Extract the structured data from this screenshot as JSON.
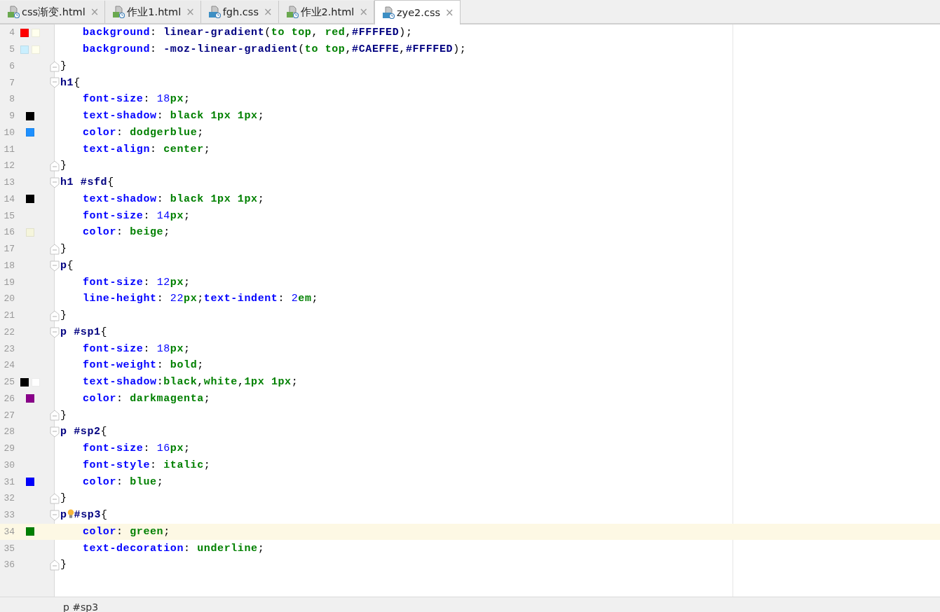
{
  "tabs": [
    {
      "label": "css渐变.html",
      "kind": "html",
      "selected": false
    },
    {
      "label": "作业1.html",
      "kind": "html",
      "selected": false
    },
    {
      "label": "fgh.css",
      "kind": "css",
      "selected": false
    },
    {
      "label": "作业2.html",
      "kind": "html",
      "selected": false
    },
    {
      "label": "zye2.css",
      "kind": "css",
      "selected": true
    }
  ],
  "tab_close": "×",
  "lines": [
    {
      "number": "4",
      "kind": "decl",
      "current": false,
      "bulb": false,
      "swatches": [
        {
          "color": "#ff0000"
        },
        {
          "color": "#ffffed"
        }
      ],
      "tokens": [
        {
          "text": "background",
          "kind": "p"
        },
        {
          "text": ": ",
          "kind": "x"
        },
        {
          "text": "linear-gradient",
          "kind": "f"
        },
        {
          "text": "(",
          "kind": "x"
        },
        {
          "text": "to top",
          "kind": "v"
        },
        {
          "text": ", ",
          "kind": "x"
        },
        {
          "text": "red",
          "kind": "v"
        },
        {
          "text": ",",
          "kind": "x"
        },
        {
          "text": "#FFFFED",
          "kind": "f"
        },
        {
          "text": ");",
          "kind": "x"
        }
      ]
    },
    {
      "number": "5",
      "kind": "decl",
      "current": false,
      "bulb": false,
      "swatches": [
        {
          "color": "#caeffe"
        },
        {
          "color": "#ffffed"
        }
      ],
      "tokens": [
        {
          "text": "background",
          "kind": "p"
        },
        {
          "text": ": ",
          "kind": "x"
        },
        {
          "text": "-moz-linear-gradient",
          "kind": "f"
        },
        {
          "text": "(",
          "kind": "x"
        },
        {
          "text": "to top",
          "kind": "v"
        },
        {
          "text": ",",
          "kind": "x"
        },
        {
          "text": "#CAEFFE",
          "kind": "f"
        },
        {
          "text": ",",
          "kind": "x"
        },
        {
          "text": "#FFFFED",
          "kind": "f"
        },
        {
          "text": ");",
          "kind": "x"
        }
      ]
    },
    {
      "number": "6",
      "kind": "close",
      "current": false,
      "bulb": false,
      "tokens": [
        {
          "text": "}",
          "kind": "x"
        }
      ]
    },
    {
      "number": "7",
      "kind": "selector",
      "current": false,
      "bulb": false,
      "tokens": [
        {
          "text": "h1",
          "kind": "s"
        },
        {
          "text": "{",
          "kind": "x"
        }
      ]
    },
    {
      "number": "8",
      "kind": "decl",
      "current": false,
      "bulb": false,
      "tokens": [
        {
          "text": "font-size",
          "kind": "p"
        },
        {
          "text": ": ",
          "kind": "x"
        },
        {
          "text": "18",
          "kind": "n"
        },
        {
          "text": "px",
          "kind": "v"
        },
        {
          "text": ";",
          "kind": "x"
        }
      ]
    },
    {
      "number": "9",
      "kind": "decl",
      "current": false,
      "bulb": false,
      "swatches": [
        {
          "color": "#000000"
        }
      ],
      "tokens": [
        {
          "text": "text-shadow",
          "kind": "p"
        },
        {
          "text": ": ",
          "kind": "x"
        },
        {
          "text": "black 1px 1px",
          "kind": "v"
        },
        {
          "text": ";",
          "kind": "x"
        }
      ]
    },
    {
      "number": "10",
      "kind": "decl",
      "current": false,
      "bulb": false,
      "swatches": [
        {
          "color": "#1e90ff"
        }
      ],
      "tokens": [
        {
          "text": "color",
          "kind": "p"
        },
        {
          "text": ": ",
          "kind": "x"
        },
        {
          "text": "dodgerblue",
          "kind": "v"
        },
        {
          "text": ";",
          "kind": "x"
        }
      ]
    },
    {
      "number": "11",
      "kind": "decl",
      "current": false,
      "bulb": false,
      "tokens": [
        {
          "text": "text-align",
          "kind": "p"
        },
        {
          "text": ": ",
          "kind": "x"
        },
        {
          "text": "center",
          "kind": "v"
        },
        {
          "text": ";",
          "kind": "x"
        }
      ]
    },
    {
      "number": "12",
      "kind": "close",
      "current": false,
      "bulb": false,
      "tokens": [
        {
          "text": "}",
          "kind": "x"
        }
      ]
    },
    {
      "number": "13",
      "kind": "selector",
      "current": false,
      "bulb": false,
      "tokens": [
        {
          "text": "h1 #sfd",
          "kind": "s"
        },
        {
          "text": "{",
          "kind": "x"
        }
      ]
    },
    {
      "number": "14",
      "kind": "decl",
      "current": false,
      "bulb": false,
      "swatches": [
        {
          "color": "#000000"
        }
      ],
      "tokens": [
        {
          "text": "text-shadow",
          "kind": "p"
        },
        {
          "text": ": ",
          "kind": "x"
        },
        {
          "text": "black 1px 1px",
          "kind": "v"
        },
        {
          "text": ";",
          "kind": "x"
        }
      ]
    },
    {
      "number": "15",
      "kind": "decl",
      "current": false,
      "bulb": false,
      "tokens": [
        {
          "text": "font-size",
          "kind": "p"
        },
        {
          "text": ": ",
          "kind": "x"
        },
        {
          "text": "14",
          "kind": "n"
        },
        {
          "text": "px",
          "kind": "v"
        },
        {
          "text": ";",
          "kind": "x"
        }
      ]
    },
    {
      "number": "16",
      "kind": "decl",
      "current": false,
      "bulb": false,
      "swatches": [
        {
          "color": "#f5f5dc"
        }
      ],
      "tokens": [
        {
          "text": "color",
          "kind": "p"
        },
        {
          "text": ": ",
          "kind": "x"
        },
        {
          "text": "beige",
          "kind": "v"
        },
        {
          "text": ";",
          "kind": "x"
        }
      ]
    },
    {
      "number": "17",
      "kind": "close",
      "current": false,
      "bulb": false,
      "tokens": [
        {
          "text": "}",
          "kind": "x"
        }
      ]
    },
    {
      "number": "18",
      "kind": "selector",
      "current": false,
      "bulb": false,
      "tokens": [
        {
          "text": "p",
          "kind": "s"
        },
        {
          "text": "{",
          "kind": "x"
        }
      ]
    },
    {
      "number": "19",
      "kind": "decl",
      "current": false,
      "bulb": false,
      "tokens": [
        {
          "text": "font-size",
          "kind": "p"
        },
        {
          "text": ": ",
          "kind": "x"
        },
        {
          "text": "12",
          "kind": "n"
        },
        {
          "text": "px",
          "kind": "v"
        },
        {
          "text": ";",
          "kind": "x"
        }
      ]
    },
    {
      "number": "20",
      "kind": "decl",
      "current": false,
      "bulb": false,
      "tokens": [
        {
          "text": "line-height",
          "kind": "p"
        },
        {
          "text": ": ",
          "kind": "x"
        },
        {
          "text": "22",
          "kind": "n"
        },
        {
          "text": "px",
          "kind": "v"
        },
        {
          "text": ";",
          "kind": "x"
        },
        {
          "text": "text-indent",
          "kind": "p"
        },
        {
          "text": ": ",
          "kind": "x"
        },
        {
          "text": "2",
          "kind": "n"
        },
        {
          "text": "em",
          "kind": "v"
        },
        {
          "text": ";",
          "kind": "x"
        }
      ]
    },
    {
      "number": "21",
      "kind": "close",
      "current": false,
      "bulb": false,
      "tokens": [
        {
          "text": "}",
          "kind": "x"
        }
      ]
    },
    {
      "number": "22",
      "kind": "selector",
      "current": false,
      "bulb": false,
      "tokens": [
        {
          "text": "p #sp1",
          "kind": "s"
        },
        {
          "text": "{",
          "kind": "x"
        }
      ]
    },
    {
      "number": "23",
      "kind": "decl",
      "current": false,
      "bulb": false,
      "tokens": [
        {
          "text": "font-size",
          "kind": "p"
        },
        {
          "text": ": ",
          "kind": "x"
        },
        {
          "text": "18",
          "kind": "n"
        },
        {
          "text": "px",
          "kind": "v"
        },
        {
          "text": ";",
          "kind": "x"
        }
      ]
    },
    {
      "number": "24",
      "kind": "decl",
      "current": false,
      "bulb": false,
      "tokens": [
        {
          "text": "font-weight",
          "kind": "p"
        },
        {
          "text": ": ",
          "kind": "x"
        },
        {
          "text": "bold",
          "kind": "v"
        },
        {
          "text": ";",
          "kind": "x"
        }
      ]
    },
    {
      "number": "25",
      "kind": "decl",
      "current": false,
      "bulb": false,
      "swatches": [
        {
          "color": "#000000"
        },
        {
          "color": "#ffffff"
        }
      ],
      "tokens": [
        {
          "text": "text-shadow",
          "kind": "p"
        },
        {
          "text": ":",
          "kind": "x"
        },
        {
          "text": "black",
          "kind": "v"
        },
        {
          "text": ",",
          "kind": "x"
        },
        {
          "text": "white",
          "kind": "v"
        },
        {
          "text": ",",
          "kind": "x"
        },
        {
          "text": "1px 1px",
          "kind": "v"
        },
        {
          "text": ";",
          "kind": "x"
        }
      ]
    },
    {
      "number": "26",
      "kind": "decl",
      "current": false,
      "bulb": false,
      "swatches": [
        {
          "color": "#8b008b"
        }
      ],
      "tokens": [
        {
          "text": "color",
          "kind": "p"
        },
        {
          "text": ": ",
          "kind": "x"
        },
        {
          "text": "darkmagenta",
          "kind": "v"
        },
        {
          "text": ";",
          "kind": "x"
        }
      ]
    },
    {
      "number": "27",
      "kind": "close",
      "current": false,
      "bulb": false,
      "tokens": [
        {
          "text": "}",
          "kind": "x"
        }
      ]
    },
    {
      "number": "28",
      "kind": "selector",
      "current": false,
      "bulb": false,
      "tokens": [
        {
          "text": "p #sp2",
          "kind": "s"
        },
        {
          "text": "{",
          "kind": "x"
        }
      ]
    },
    {
      "number": "29",
      "kind": "decl",
      "current": false,
      "bulb": false,
      "tokens": [
        {
          "text": "font-size",
          "kind": "p"
        },
        {
          "text": ": ",
          "kind": "x"
        },
        {
          "text": "16",
          "kind": "n"
        },
        {
          "text": "px",
          "kind": "v"
        },
        {
          "text": ";",
          "kind": "x"
        }
      ]
    },
    {
      "number": "30",
      "kind": "decl",
      "current": false,
      "bulb": false,
      "tokens": [
        {
          "text": "font-style",
          "kind": "p"
        },
        {
          "text": ": ",
          "kind": "x"
        },
        {
          "text": "italic",
          "kind": "v"
        },
        {
          "text": ";",
          "kind": "x"
        }
      ]
    },
    {
      "number": "31",
      "kind": "decl",
      "current": false,
      "bulb": false,
      "swatches": [
        {
          "color": "#0000ff"
        }
      ],
      "tokens": [
        {
          "text": "color",
          "kind": "p"
        },
        {
          "text": ": ",
          "kind": "x"
        },
        {
          "text": "blue",
          "kind": "v"
        },
        {
          "text": ";",
          "kind": "x"
        }
      ]
    },
    {
      "number": "32",
      "kind": "close",
      "current": false,
      "bulb": false,
      "tokens": [
        {
          "text": "}",
          "kind": "x"
        }
      ]
    },
    {
      "number": "33",
      "kind": "selector",
      "current": false,
      "bulb": true,
      "tokens": [
        {
          "text": "p",
          "kind": "s"
        },
        {
          "text": "#sp3",
          "kind": "s"
        },
        {
          "text": "{",
          "kind": "x"
        }
      ]
    },
    {
      "number": "34",
      "kind": "decl",
      "current": true,
      "bulb": false,
      "swatches": [
        {
          "color": "#008000"
        }
      ],
      "tokens": [
        {
          "text": "color",
          "kind": "p"
        },
        {
          "text": ": ",
          "kind": "x"
        },
        {
          "text": "green",
          "kind": "v"
        },
        {
          "text": ";",
          "kind": "x"
        }
      ]
    },
    {
      "number": "35",
      "kind": "decl",
      "current": false,
      "bulb": false,
      "tokens": [
        {
          "text": "text-decoration",
          "kind": "p"
        },
        {
          "text": ": ",
          "kind": "x"
        },
        {
          "text": "underline",
          "kind": "v"
        },
        {
          "text": ";",
          "kind": "x"
        }
      ]
    },
    {
      "number": "36",
      "kind": "close",
      "current": false,
      "bulb": false,
      "tokens": [
        {
          "text": "}",
          "kind": "x"
        }
      ]
    }
  ],
  "breadcrumb": "p #sp3"
}
